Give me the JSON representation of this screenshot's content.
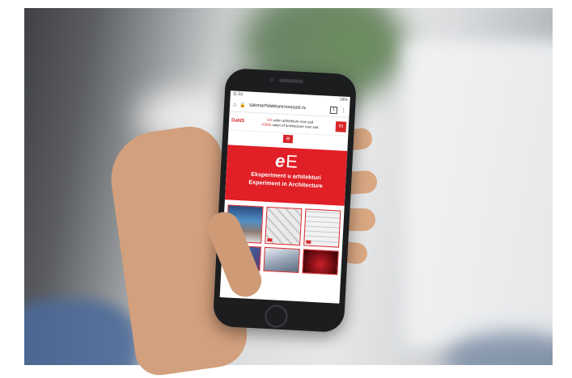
{
  "status_bar": {
    "time": "11:23",
    "right": "18%"
  },
  "browser": {
    "url": "salonarhitekturenovisad.rs",
    "tab_count": "1"
  },
  "banner": {
    "logo": "DaNS",
    "line1_red": "SS",
    "line1_rest": " salon arhitekture novi sad",
    "line2_red": "ASNS",
    "line2_rest": " salon of architecture novi sad",
    "badge": "55"
  },
  "menu_icon": "hamburger-menu-icon",
  "hero": {
    "logo_italic": "e",
    "logo_rest": "E",
    "title_sr": "Eksperiment u arhitekturi",
    "title_en": "Experiment in Architecture"
  },
  "colors": {
    "accent_red": "#e01f26",
    "phone_body": "#1c1d1f"
  }
}
